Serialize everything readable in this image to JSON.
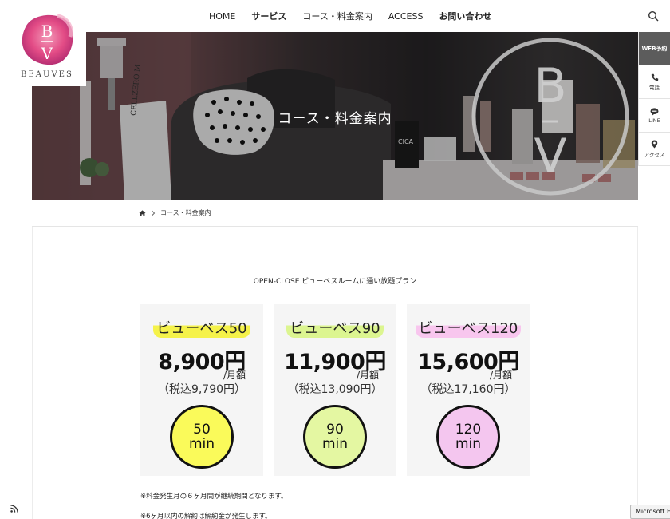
{
  "logo": {
    "letters": "B",
    "letters2": "V",
    "name": "BEAUVES"
  },
  "nav": {
    "items": [
      {
        "label": "HOME",
        "bold": false
      },
      {
        "label": "サービス",
        "bold": true
      },
      {
        "label": "コース・料金案内",
        "bold": false
      },
      {
        "label": "ACCESS",
        "bold": false
      },
      {
        "label": "お問い合わせ",
        "bold": true
      }
    ]
  },
  "hero": {
    "title": "コース・料金案内",
    "sign_text": "CELLZERO M",
    "bottle_text": "CICA",
    "monogram_top": "B",
    "monogram_bottom": "V"
  },
  "side_menu": {
    "web": "WEB予約",
    "phone": "電話",
    "line": "LINE",
    "access": "アクセス"
  },
  "breadcrumb": {
    "current": "コース・料金案内"
  },
  "plan_heading": "OPEN-CLOSE ビューベスルームに通い放題プラン",
  "plans": [
    {
      "name": "ビューベス50",
      "price": "8,900円",
      "monthly": "/月額",
      "tax": "（税込9,790円）",
      "minutes": "50",
      "unit": "min",
      "highlight": "#f5f24a",
      "circle": "#fafa5a"
    },
    {
      "name": "ビューベス90",
      "price": "11,900円",
      "monthly": "/月額",
      "tax": "（税込13,090円）",
      "minutes": "90",
      "unit": "min",
      "highlight": "#dcf590",
      "circle": "#e4f7a2"
    },
    {
      "name": "ビューベス120",
      "price": "15,600円",
      "monthly": "/月額",
      "tax": "（税込17,160円）",
      "minutes": "120",
      "unit": "min",
      "highlight": "#f8c6ee",
      "circle": "#f4c6ef"
    }
  ],
  "notes": [
    "※料金発生月の６ヶ月間が継続期間となります。",
    "※6ヶ月以内の解約は解約金が発生します。"
  ],
  "taskbar_label": "Microsoft Ex",
  "colors": {
    "side_web_bg": "#5c5c5c",
    "card_bg": "#f5f5f5",
    "logo_pink": "#e34c86"
  }
}
